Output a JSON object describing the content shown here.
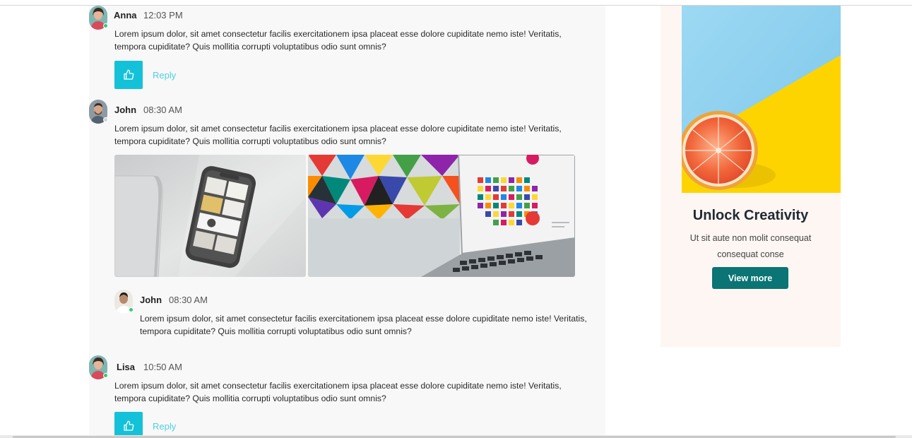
{
  "comments": [
    {
      "name": "Anna",
      "time": "12:03 PM",
      "text": "Lorem ipsum dolor, sit amet consectetur facilis exercitationem ipsa placeat esse dolore cupiditate nemo iste! Veritatis, tempora cupiditate? Quis mollitia corrupti voluptatibus odio sunt omnis?",
      "reply_label": "Reply"
    },
    {
      "name": "John",
      "time": "08:30 AM",
      "text": "Lorem ipsum dolor, sit amet consectetur facilis exercitationem ipsa placeat esse dolore cupiditate nemo iste! Veritatis, tempora cupiditate? Quis mollitia corrupti voluptatibus odio sunt omnis?"
    },
    {
      "name": "John",
      "time": "08:30 AM",
      "text": "Lorem ipsum dolor, sit amet consectetur facilis exercitationem ipsa placeat esse dolore cupiditate nemo iste! Veritatis, tempora cupiditate? Quis mollitia corrupti voluptatibus odio sunt omnis?"
    },
    {
      "name": "Lisa",
      "time": "10:50 AM",
      "text": "Lorem ipsum dolor, sit amet consectetur facilis exercitationem ipsa placeat esse dolore cupiditate nemo iste! Veritatis, tempora cupiditate? Quis mollitia corrupti voluptatibus odio sunt omnis?",
      "reply_label": "Reply"
    }
  ],
  "ad": {
    "title": "Unlock Creativity",
    "subtitle": "Ut sit aute non molit consequat consequat conse",
    "button_label": "View more"
  },
  "colors": {
    "like_button": "#13c2d8",
    "reply_link": "#4fd1e0",
    "ad_button": "#0b7474",
    "online_status": "#2ecc71"
  },
  "icons": {
    "like": "thumbs-up-icon"
  }
}
